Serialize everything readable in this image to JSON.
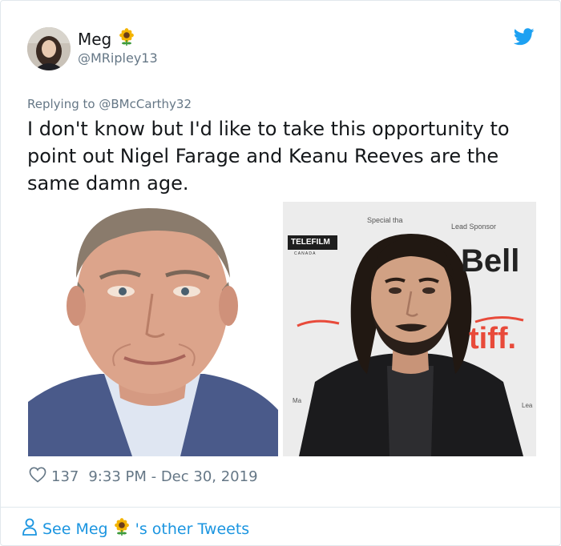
{
  "author": {
    "name": "Meg",
    "handle": "@MRipley13",
    "emoji": "🌻"
  },
  "tweet": {
    "replying_prefix": "Replying to",
    "replying_to": "@BMcCarthy32",
    "text": "I don't know but I'd like to take this opportunity to point out Nigel Farage and Keanu Reeves are the same damn age."
  },
  "photo_right": {
    "sign_special": "Special tha",
    "sign_lead": "Lead Sponsor",
    "sign_telefilm": "TELEFILM",
    "sign_canada": "C A N A D A",
    "sign_bell": "Bell",
    "sign_tiff": "tiff.",
    "sign_lea": "Lea",
    "sign_ma": "Ma"
  },
  "meta": {
    "likes": "137",
    "timestamp": "9:33 PM - Dec 30, 2019"
  },
  "footer": {
    "see": "See Meg",
    "other": "'s other Tweets"
  },
  "colors": {
    "link": "#1b95e0",
    "muted": "#657786",
    "text": "#14171a",
    "twitter_blue": "#1da1f2"
  },
  "icons": [
    "twitter-bird-icon",
    "heart-icon",
    "person-icon",
    "sunflower-emoji"
  ]
}
